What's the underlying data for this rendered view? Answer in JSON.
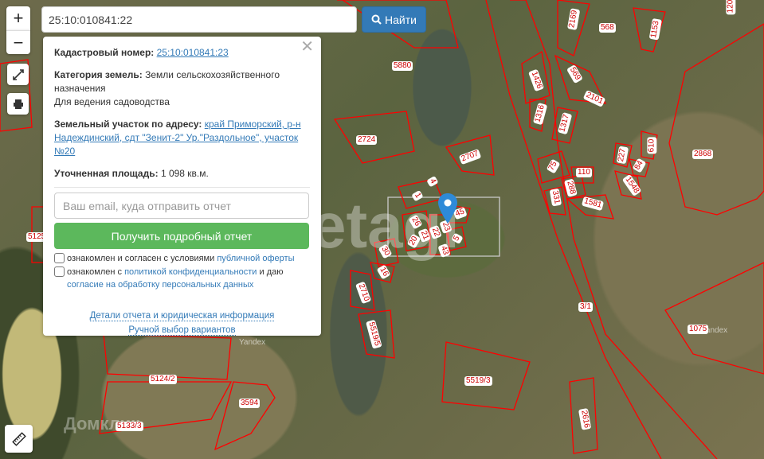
{
  "search": {
    "value": "25:10:010841:22",
    "button": "Найти"
  },
  "popup": {
    "cad_label": "Кадастровый номер:",
    "cad_value": "25:10:010841:23",
    "cat_label": "Категория земель:",
    "cat_value": "Земли сельскохозяйственного назначения",
    "use": "Для ведения садоводства",
    "addr_label": "Земельный участок по адресу:",
    "addr_value": "край Приморский, р-н Надеждинский, сдт \"Зенит-2\" Ур.\"Раздольное\", участок №20",
    "area_label": "Уточненная площадь:",
    "area_value": "1 098 кв.м.",
    "email_placeholder": "Ваш email, куда отправить отчет",
    "get_button": "Получить подробный отчет",
    "chk1_text": "ознакомлен и согласен с условиями ",
    "chk1_link": "публичной оферты",
    "chk2_text": "ознакомлен с ",
    "chk2_link": "политикой конфиденциальности",
    "chk2_mid": " и даю ",
    "chk2_link2": "согласие на обработку персональных данных",
    "details_link": "Детали отчета и юридическая информация",
    "manual_link": "Ручной выбор вариантов"
  },
  "controls": {
    "zoom_in": "+",
    "zoom_out": "−"
  },
  "map": {
    "labels": [
      "5880",
      "2724",
      "2707",
      "4",
      "1",
      "45",
      "26",
      "21",
      "22",
      "23",
      "20",
      "5",
      "43",
      "30",
      "16",
      "2710",
      "5519/5",
      "5519/3",
      "3/1",
      "1075",
      "2616",
      "3594",
      "5124/2",
      "5133/3",
      "568",
      "2169",
      "1153",
      "1426",
      "569",
      "2101",
      "1316",
      "1317",
      "75",
      "110",
      "288",
      "331",
      "1581",
      "227",
      "84",
      "1548",
      "610",
      "2868",
      "5125",
      "120"
    ],
    "watermarks": [
      "Yandex",
      "Yandex",
      "Домклик",
      "etagi"
    ],
    "colors": {
      "parcel": "#ff0000",
      "marker": "#2e8ad8"
    }
  }
}
